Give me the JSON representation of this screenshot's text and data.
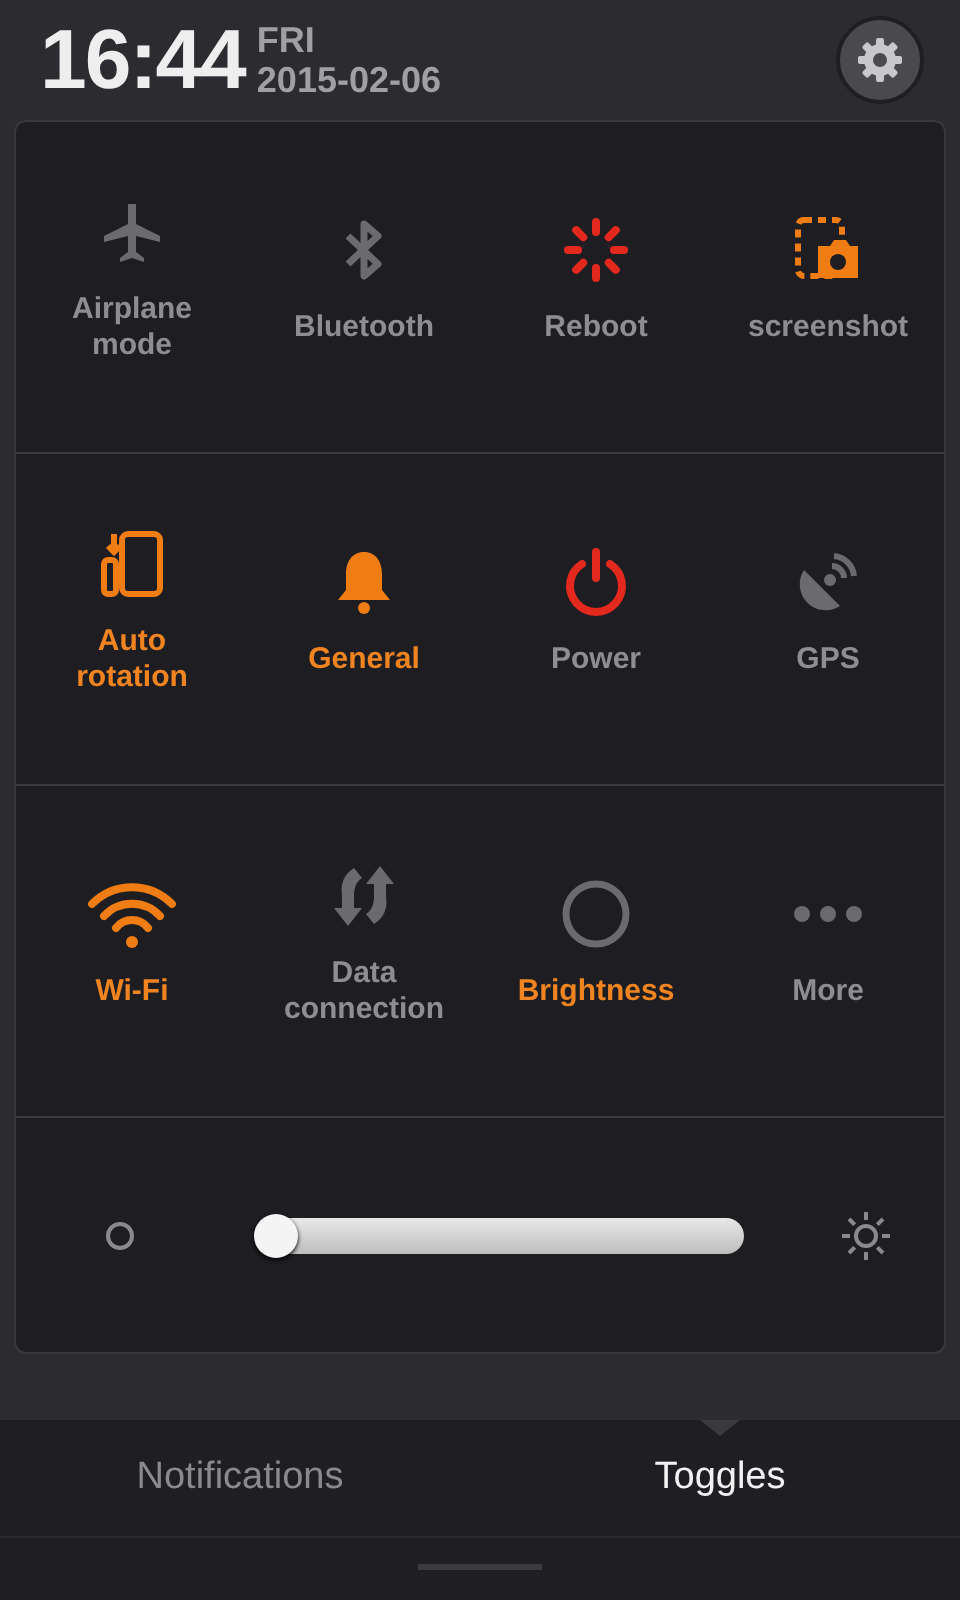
{
  "header": {
    "time": "16:44",
    "day": "FRI",
    "date": "2015-02-06"
  },
  "toggles": [
    {
      "kind": "airplane",
      "label": "Airplane mode",
      "on": false,
      "color": "#6b6b6d"
    },
    {
      "kind": "bluetooth",
      "label": "Bluetooth",
      "on": false,
      "color": "#6b6b6d"
    },
    {
      "kind": "reboot",
      "label": "Reboot",
      "on": false,
      "color": "#e3281e"
    },
    {
      "kind": "screenshot",
      "label": "screenshot",
      "on": false,
      "color": "#f07c14"
    },
    {
      "kind": "rotation",
      "label": "Auto rotation",
      "on": true,
      "color": "#f07c14"
    },
    {
      "kind": "bell",
      "label": "General",
      "on": true,
      "color": "#f07c14"
    },
    {
      "kind": "power",
      "label": "Power",
      "on": false,
      "color": "#e3281e"
    },
    {
      "kind": "gps",
      "label": "GPS",
      "on": false,
      "color": "#6b6b6d"
    },
    {
      "kind": "wifi",
      "label": "Wi-Fi",
      "on": true,
      "color": "#f07c14"
    },
    {
      "kind": "data",
      "label": "Data connection",
      "on": false,
      "color": "#6b6b6d"
    },
    {
      "kind": "ring",
      "label": "Brightness",
      "on": true,
      "color": "#6b6b6d"
    },
    {
      "kind": "dots",
      "label": "More",
      "on": false,
      "color": "#6b6b6d"
    }
  ],
  "brightness": {
    "level": 0.02
  },
  "tabs": [
    {
      "label": "Notifications",
      "selected": false
    },
    {
      "label": "Toggles",
      "selected": true
    }
  ]
}
